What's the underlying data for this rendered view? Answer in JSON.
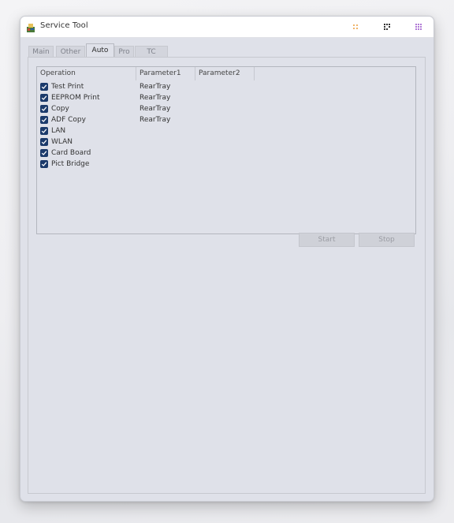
{
  "window": {
    "title": "Service Tool"
  },
  "tabs": [
    {
      "label": "Main",
      "active": false
    },
    {
      "label": "Other",
      "active": false
    },
    {
      "label": "Auto",
      "active": true
    },
    {
      "label": "Pro",
      "active": false
    },
    {
      "label": "TC",
      "active": false
    }
  ],
  "list": {
    "columns": [
      "Operation",
      "Parameter1",
      "Parameter2"
    ],
    "rows": [
      {
        "checked": true,
        "operation": "Test Print",
        "parameter1": "RearTray",
        "parameter2": ""
      },
      {
        "checked": true,
        "operation": "EEPROM Print",
        "parameter1": "RearTray",
        "parameter2": ""
      },
      {
        "checked": true,
        "operation": "Copy",
        "parameter1": "RearTray",
        "parameter2": ""
      },
      {
        "checked": true,
        "operation": "ADF Copy",
        "parameter1": "RearTray",
        "parameter2": ""
      },
      {
        "checked": true,
        "operation": "LAN",
        "parameter1": "",
        "parameter2": ""
      },
      {
        "checked": true,
        "operation": "WLAN",
        "parameter1": "",
        "parameter2": ""
      },
      {
        "checked": true,
        "operation": "Card Board",
        "parameter1": "",
        "parameter2": ""
      },
      {
        "checked": true,
        "operation": "Pict Bridge",
        "parameter1": "",
        "parameter2": ""
      }
    ]
  },
  "buttons": {
    "start_label": "Start",
    "stop_label": "Stop"
  },
  "colors": {
    "window_bg": "#dfe1e9",
    "checkbox": "#1b3a6b",
    "minimize_accent": "#f0b56a",
    "maximize_accent": "#333333",
    "close_accent": "#b07ad6"
  },
  "icons": {
    "app": "printer-app-icon",
    "minimize": "minimize-icon",
    "maximize": "maximize-icon",
    "close": "close-icon",
    "checkbox": "checkmark-icon"
  }
}
